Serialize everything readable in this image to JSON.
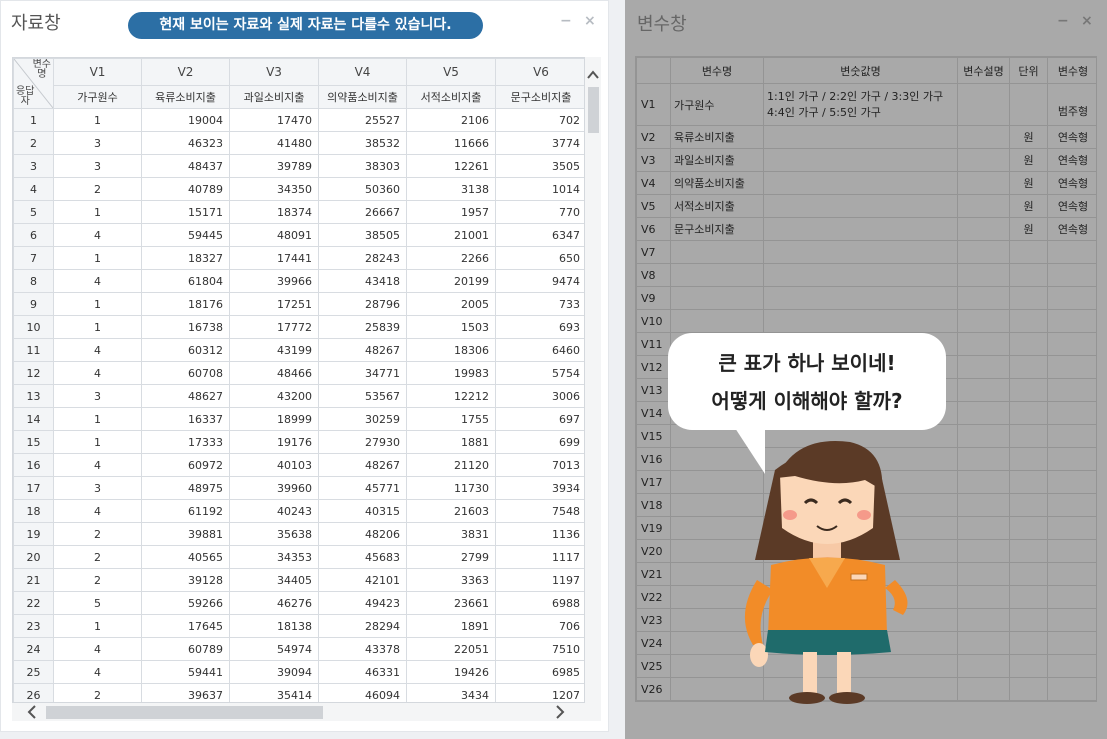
{
  "data_window": {
    "title": "자료창",
    "notice": "현재 보이는 자료와 실제 자료는 다를수 있습니다.",
    "minimize": "−",
    "close": "×",
    "corner_top": "변수\n명",
    "corner_bottom": "응답\n자",
    "columns": [
      {
        "id": "V1",
        "label": "가구원수"
      },
      {
        "id": "V2",
        "label": "육류소비지출"
      },
      {
        "id": "V3",
        "label": "과일소비지출"
      },
      {
        "id": "V4",
        "label": "의약품소비지출"
      },
      {
        "id": "V5",
        "label": "서적소비지출"
      },
      {
        "id": "V6",
        "label": "문구소비지출"
      }
    ],
    "rows": [
      [
        "1",
        "1",
        "19004",
        "17470",
        "25527",
        "2106",
        "702"
      ],
      [
        "2",
        "3",
        "46323",
        "41480",
        "38532",
        "11666",
        "3774"
      ],
      [
        "3",
        "3",
        "48437",
        "39789",
        "38303",
        "12261",
        "3505"
      ],
      [
        "4",
        "2",
        "40789",
        "34350",
        "50360",
        "3138",
        "1014"
      ],
      [
        "5",
        "1",
        "15171",
        "18374",
        "26667",
        "1957",
        "770"
      ],
      [
        "6",
        "4",
        "59445",
        "48091",
        "38505",
        "21001",
        "6347"
      ],
      [
        "7",
        "1",
        "18327",
        "17441",
        "28243",
        "2266",
        "650"
      ],
      [
        "8",
        "4",
        "61804",
        "39966",
        "43418",
        "20199",
        "9474"
      ],
      [
        "9",
        "1",
        "18176",
        "17251",
        "28796",
        "2005",
        "733"
      ],
      [
        "10",
        "1",
        "16738",
        "17772",
        "25839",
        "1503",
        "693"
      ],
      [
        "11",
        "4",
        "60312",
        "43199",
        "48267",
        "18306",
        "6460"
      ],
      [
        "12",
        "4",
        "60708",
        "48466",
        "34771",
        "19983",
        "5754"
      ],
      [
        "13",
        "3",
        "48627",
        "43200",
        "53567",
        "12212",
        "3006"
      ],
      [
        "14",
        "1",
        "16337",
        "18999",
        "30259",
        "1755",
        "697"
      ],
      [
        "15",
        "1",
        "17333",
        "19176",
        "27930",
        "1881",
        "699"
      ],
      [
        "16",
        "4",
        "60972",
        "40103",
        "48267",
        "21120",
        "7013"
      ],
      [
        "17",
        "3",
        "48975",
        "39960",
        "45771",
        "11730",
        "3934"
      ],
      [
        "18",
        "4",
        "61192",
        "40243",
        "40315",
        "21603",
        "7548"
      ],
      [
        "19",
        "2",
        "39881",
        "35638",
        "48206",
        "3831",
        "1136"
      ],
      [
        "20",
        "2",
        "40565",
        "34353",
        "45683",
        "2799",
        "1117"
      ],
      [
        "21",
        "2",
        "39128",
        "34405",
        "42101",
        "3363",
        "1197"
      ],
      [
        "22",
        "5",
        "59266",
        "46276",
        "49423",
        "23661",
        "6988"
      ],
      [
        "23",
        "1",
        "17645",
        "18138",
        "28294",
        "1891",
        "706"
      ],
      [
        "24",
        "4",
        "60789",
        "54974",
        "43378",
        "22051",
        "7510"
      ],
      [
        "25",
        "4",
        "59441",
        "39094",
        "46331",
        "19426",
        "6985"
      ],
      [
        "26",
        "2",
        "39637",
        "35414",
        "46094",
        "3434",
        "1207"
      ]
    ]
  },
  "variable_window": {
    "title": "변수창",
    "minimize": "−",
    "close": "×",
    "headers": [
      "",
      "변수명",
      "변숫값명",
      "변수설명",
      "단위",
      "변수형"
    ],
    "rows": [
      {
        "id": "V1",
        "name": "가구원수",
        "value_label_1": "1:1인 가구 / 2:2인 가구 / 3:3인 가구",
        "value_label_2": "4:4인 가구 / 5:5인 가구",
        "desc": "",
        "unit": "",
        "type": "범주형"
      },
      {
        "id": "V2",
        "name": "육류소비지출",
        "value_label_1": "",
        "value_label_2": "",
        "desc": "",
        "unit": "원",
        "type": "연속형"
      },
      {
        "id": "V3",
        "name": "과일소비지출",
        "value_label_1": "",
        "value_label_2": "",
        "desc": "",
        "unit": "원",
        "type": "연속형"
      },
      {
        "id": "V4",
        "name": "의약품소비지출",
        "value_label_1": "",
        "value_label_2": "",
        "desc": "",
        "unit": "원",
        "type": "연속형"
      },
      {
        "id": "V5",
        "name": "서적소비지출",
        "value_label_1": "",
        "value_label_2": "",
        "desc": "",
        "unit": "원",
        "type": "연속형"
      },
      {
        "id": "V6",
        "name": "문구소비지출",
        "value_label_1": "",
        "value_label_2": "",
        "desc": "",
        "unit": "원",
        "type": "연속형"
      }
    ],
    "empty_rows": [
      "V7",
      "V8",
      "V9",
      "V10",
      "V11",
      "V12",
      "V13",
      "V14",
      "V15",
      "V16",
      "V17",
      "V18",
      "V19",
      "V20",
      "V21",
      "V22",
      "V23",
      "V24",
      "V25",
      "V26"
    ]
  },
  "bubble": {
    "line1": "큰 표가 하나 보이네!",
    "line2": "어떻게 이해해야 할까?"
  },
  "icons": {
    "scroll_up": "chevron-up-icon",
    "scroll_left": "chevron-left-icon",
    "scroll_right": "chevron-right-icon"
  },
  "colors": {
    "notice_bg": "#2c6fa5",
    "overlay": "#a9a9a9",
    "character_shirt": "#f28c28",
    "character_skirt": "#1f6b6b"
  }
}
